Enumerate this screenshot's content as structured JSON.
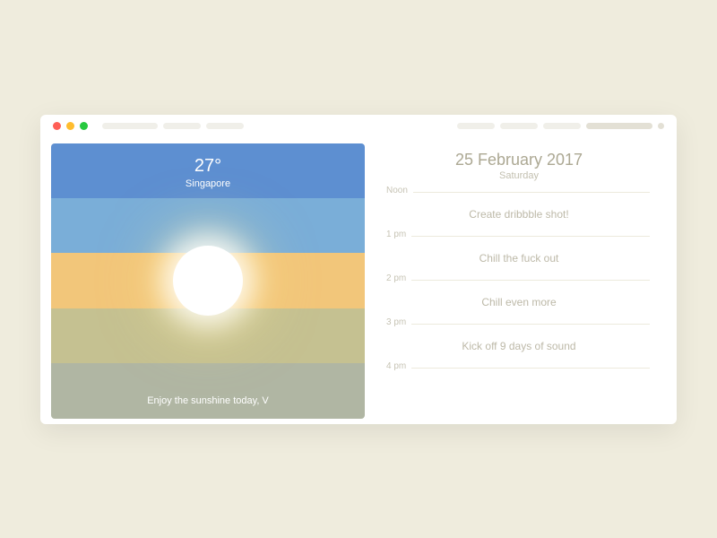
{
  "weather": {
    "temperature": "27°",
    "location": "Singapore",
    "greeting": "Enjoy the sunshine today, V"
  },
  "schedule": {
    "date": "25 February 2017",
    "day": "Saturday",
    "slots": [
      {
        "time": "Noon",
        "event": "Create dribbble shot!"
      },
      {
        "time": "1 pm",
        "event": "Chill the fuck out"
      },
      {
        "time": "2 pm",
        "event": "Chill even more"
      },
      {
        "time": "3 pm",
        "event": "Kick off 9 days of sound"
      },
      {
        "time": "4 pm",
        "event": ""
      }
    ]
  }
}
